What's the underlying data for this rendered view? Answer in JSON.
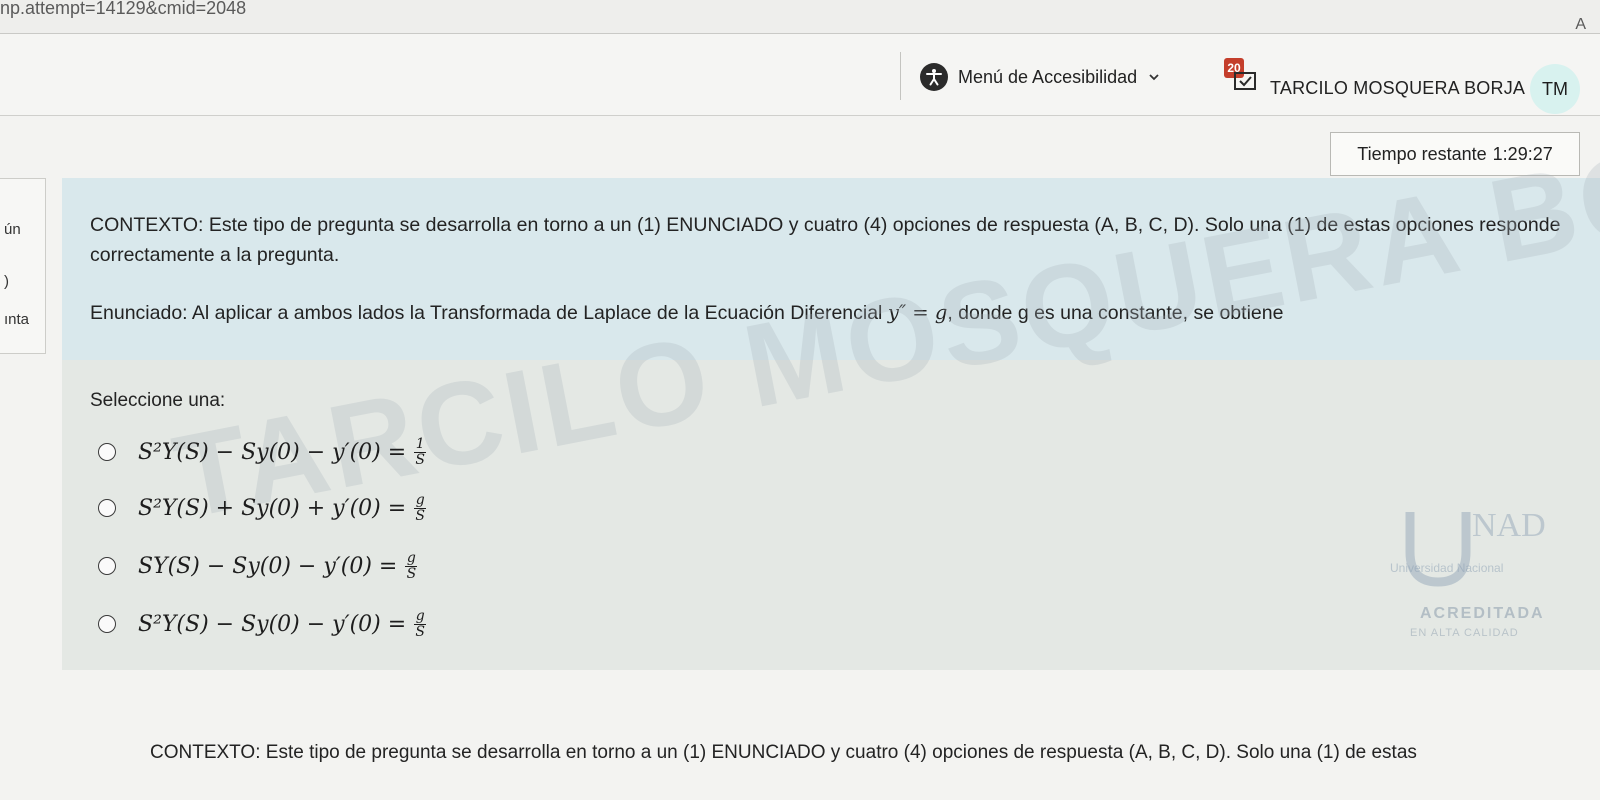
{
  "browser": {
    "url_fragment": "np.attempt=14129&cmid=2048",
    "corner_char": "A"
  },
  "header": {
    "accessibility_label": "Menú de Accesibilidad",
    "messages_count": "20",
    "user_name": "TARCILO MOSQUERA BORJA",
    "avatar_initials": "TM"
  },
  "timer": {
    "label": "Tiempo restante",
    "value": "1:29:27"
  },
  "left_nav": {
    "line1": "ún",
    "line2": ")",
    "line3": "ınta"
  },
  "question": {
    "context": "CONTEXTO: Este tipo de pregunta se desarrolla en torno a un (1) ENUNCIADO y cuatro (4) opciones de respuesta (A, B, C, D). Solo una (1) de estas opciones responde correctamente a la pregunta.",
    "statement_before": "Enunciado: Al aplicar a ambos lados la Transformada de Laplace de la Ecuación Diferencial",
    "equation": "y″ = g",
    "statement_after": ", donde g es una constante, se obtiene"
  },
  "answers": {
    "select_label": "Seleccione una:",
    "options": [
      {
        "lhs": "S²Y(S) − Sy(0) − y′(0) =",
        "num": "1",
        "den": "S"
      },
      {
        "lhs": "S²Y(S) + Sy(0) + y′(0) =",
        "num": "g",
        "den": "S"
      },
      {
        "lhs": "SY(S) − Sy(0) − y′(0) =",
        "num": "g",
        "den": "S"
      },
      {
        "lhs": "S²Y(S) − Sy(0) − y′(0) =",
        "num": "g",
        "den": "S"
      }
    ]
  },
  "watermark": {
    "line1": "TARCILO MOSQUERA BORJA"
  },
  "logo": {
    "letters": "UNAD",
    "subtitle": "Universidad Nacional",
    "badge": "ACREDITADA",
    "badge_sub": "EN ALTA CALIDAD"
  },
  "footer": {
    "context_repeat": "CONTEXTO: Este tipo de pregunta se desarrolla en torno a un (1) ENUNCIADO y cuatro (4) opciones de respuesta (A, B, C, D). Solo una (1) de estas"
  },
  "colors": {
    "question_bg": "#d9e8ec",
    "answer_bg": "#e4e8e4",
    "avatar_bg": "#d8f2ef",
    "badge_red": "#c43e2b"
  }
}
